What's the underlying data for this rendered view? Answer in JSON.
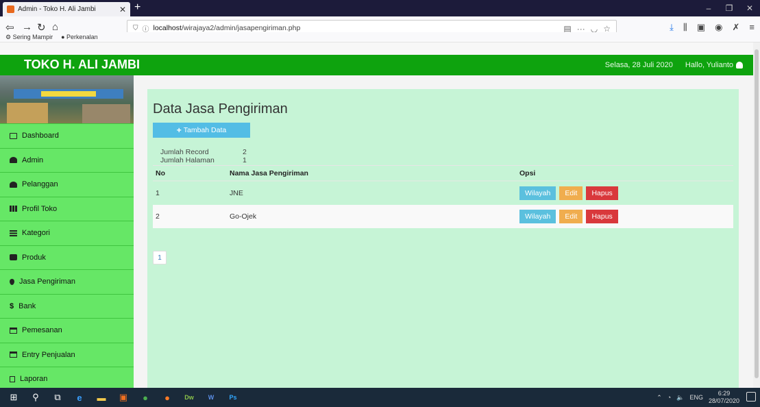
{
  "browser": {
    "tab_title": "Admin - Toko H. Ali Jambi",
    "url_prefix": "localhost",
    "url_path": "/wirajaya2/admin/jasapengiriman.php",
    "bookmarks": [
      "Sering Mampir",
      "Perkenalan"
    ]
  },
  "header": {
    "brand": "TOKO H. ALI JAMBI",
    "date": "Selasa, 28 Juli 2020",
    "greeting": "Hallo, Yulianto"
  },
  "sidebar": {
    "items": [
      {
        "label": "Dashboard",
        "icon": "monitor-icon"
      },
      {
        "label": "Admin",
        "icon": "user-icon"
      },
      {
        "label": "Pelanggan",
        "icon": "users-icon"
      },
      {
        "label": "Profil Toko",
        "icon": "table-icon"
      },
      {
        "label": "Kategori",
        "icon": "list-icon"
      },
      {
        "label": "Produk",
        "icon": "briefcase-icon"
      },
      {
        "label": "Jasa Pengiriman",
        "icon": "map-marker-icon"
      },
      {
        "label": "Bank",
        "icon": "dollar-icon"
      },
      {
        "label": "Pemesanan",
        "icon": "credit-card-icon"
      },
      {
        "label": "Entry Penjualan",
        "icon": "credit-card-icon"
      },
      {
        "label": "Laporan",
        "icon": "file-icon"
      }
    ]
  },
  "main": {
    "title": "Data Jasa Pengiriman",
    "add_button": "Tambah Data",
    "meta": {
      "record_label": "Jumlah Record",
      "record_value": "2",
      "pages_label": "Jumlah Halaman",
      "pages_value": "1"
    },
    "table": {
      "headers": [
        "No",
        "Nama Jasa Pengiriman",
        "Opsi"
      ],
      "rows": [
        {
          "no": "1",
          "name": "JNE"
        },
        {
          "no": "2",
          "name": "Go-Ojek"
        }
      ],
      "actions": {
        "wilayah": "Wilayah",
        "edit": "Edit",
        "hapus": "Hapus"
      }
    },
    "pagination": [
      "1"
    ]
  },
  "taskbar": {
    "language": "ENG",
    "time": "6:29",
    "date": "28/07/2020"
  }
}
